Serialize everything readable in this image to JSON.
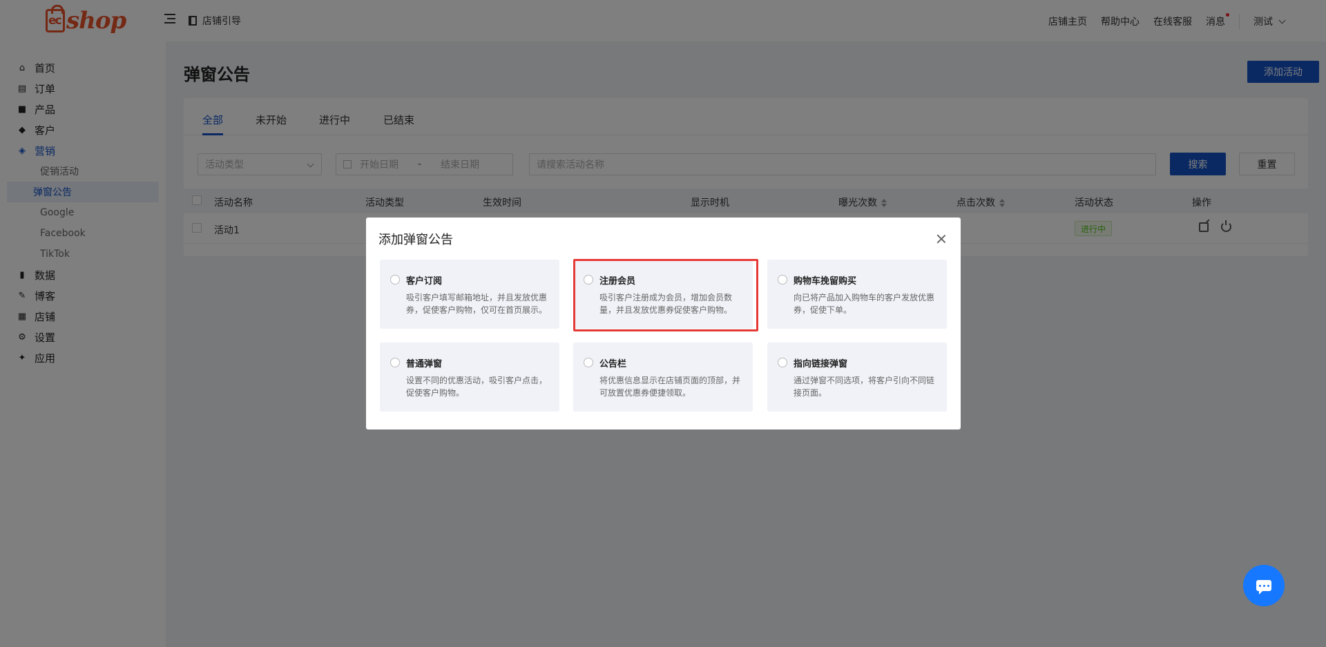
{
  "header": {
    "logo_text": "shop",
    "logo_mark": "ec",
    "guide_label": "店铺引导",
    "links": [
      "店铺主页",
      "帮助中心",
      "在线客服",
      "消息"
    ],
    "user_name": "测试"
  },
  "sidebar": {
    "items": [
      {
        "label": "首页",
        "icon": "home-icon"
      },
      {
        "label": "订单",
        "icon": "order-icon"
      },
      {
        "label": "产品",
        "icon": "bag-icon"
      },
      {
        "label": "客户",
        "icon": "diamond-icon"
      },
      {
        "label": "营销",
        "icon": "tag-icon",
        "active": true
      },
      {
        "label": "数据",
        "icon": "chart-icon"
      },
      {
        "label": "博客",
        "icon": "edit-icon"
      },
      {
        "label": "店铺",
        "icon": "store-icon"
      },
      {
        "label": "设置",
        "icon": "gear-icon"
      },
      {
        "label": "应用",
        "icon": "puzzle-icon"
      }
    ],
    "sub_items": [
      "促销活动",
      "弹窗公告",
      "Google",
      "Facebook",
      "TikTok"
    ]
  },
  "main": {
    "title": "弹窗公告",
    "add_button": "添加活动",
    "tabs": [
      "全部",
      "未开始",
      "进行中",
      "已结束"
    ],
    "filters": {
      "type_placeholder": "活动类型",
      "start_date": "开始日期",
      "date_sep": "-",
      "end_date": "结束日期",
      "search_placeholder": "请搜索活动名称"
    },
    "search_button": "搜索",
    "reset_button": "重置",
    "table": {
      "columns": [
        "活动名称",
        "活动类型",
        "生效时间",
        "显示时机",
        "曝光次数",
        "点击次数",
        "活动状态",
        "操作"
      ],
      "rows": [
        {
          "name": "活动1",
          "status": "进行中"
        }
      ]
    }
  },
  "modal": {
    "title": "添加弹窗公告",
    "options": [
      {
        "title": "客户订阅",
        "desc": "吸引客户填写邮箱地址，并且发放优惠券，促使客户购物，仅可在首页展示。"
      },
      {
        "title": "注册会员",
        "desc": "吸引客户注册成为会员，增加会员数量，并且发放优惠券促使客户购物。"
      },
      {
        "title": "购物车挽留购买",
        "desc": "向已将产品加入购物车的客户发放优惠券，促使下单。"
      },
      {
        "title": "普通弹窗",
        "desc": "设置不同的优惠活动，吸引客户点击，促使客户购物。"
      },
      {
        "title": "公告栏",
        "desc": "将优惠信息显示在店铺页面的顶部，并可放置优惠券便捷领取。"
      },
      {
        "title": "指向链接弹窗",
        "desc": "通过弹窗不同选项，将客户引向不同链接页面。"
      }
    ]
  },
  "colors": {
    "primary": "#1552c6",
    "brand": "#e8522a",
    "highlight": "#e53935",
    "status_green": "#52c41a"
  }
}
